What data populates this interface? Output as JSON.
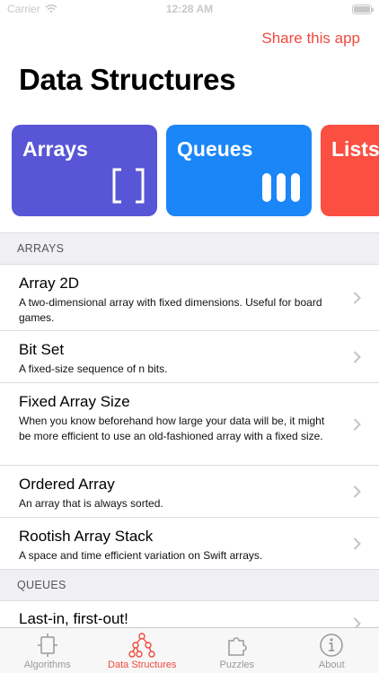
{
  "status_bar": {
    "carrier": "Carrier",
    "time": "12:28 AM"
  },
  "header": {
    "share_label": "Share this app",
    "title": "Data Structures"
  },
  "cards": [
    {
      "label": "Arrays",
      "color": "#5856d6",
      "icon": "brackets-icon"
    },
    {
      "label": "Queues",
      "color": "#1a86f7",
      "icon": "bars-icon"
    },
    {
      "label": "Lists",
      "color": "#fb4f41",
      "icon": "none"
    }
  ],
  "sections": {
    "arrays": {
      "header": "ARRAYS",
      "rows": [
        {
          "title": "Array 2D",
          "subtitle": "A two-dimensional array with fixed dimensions. Useful for board games."
        },
        {
          "title": "Bit Set",
          "subtitle": "A fixed-size sequence of n bits."
        },
        {
          "title": "Fixed Array Size",
          "subtitle": "When you know beforehand how large your data will be, it might be more efficient to use an old-fashioned array with a fixed size."
        },
        {
          "title": "Ordered Array",
          "subtitle": "An array that is always sorted."
        },
        {
          "title": "Rootish Array Stack",
          "subtitle": "A space and time efficient variation on Swift arrays."
        }
      ]
    },
    "queues": {
      "header": "QUEUES",
      "rows": [
        {
          "title": "Last-in, first-out!"
        }
      ]
    }
  },
  "tab_bar": {
    "active_color": "#ef4a3e",
    "tabs": [
      {
        "label": "Algorithms",
        "icon": "flowchart-icon",
        "active": false
      },
      {
        "label": "Data Structures",
        "icon": "tree-icon",
        "active": true
      },
      {
        "label": "Puzzles",
        "icon": "puzzle-icon",
        "active": false
      },
      {
        "label": "About",
        "icon": "info-icon",
        "active": false
      }
    ]
  }
}
